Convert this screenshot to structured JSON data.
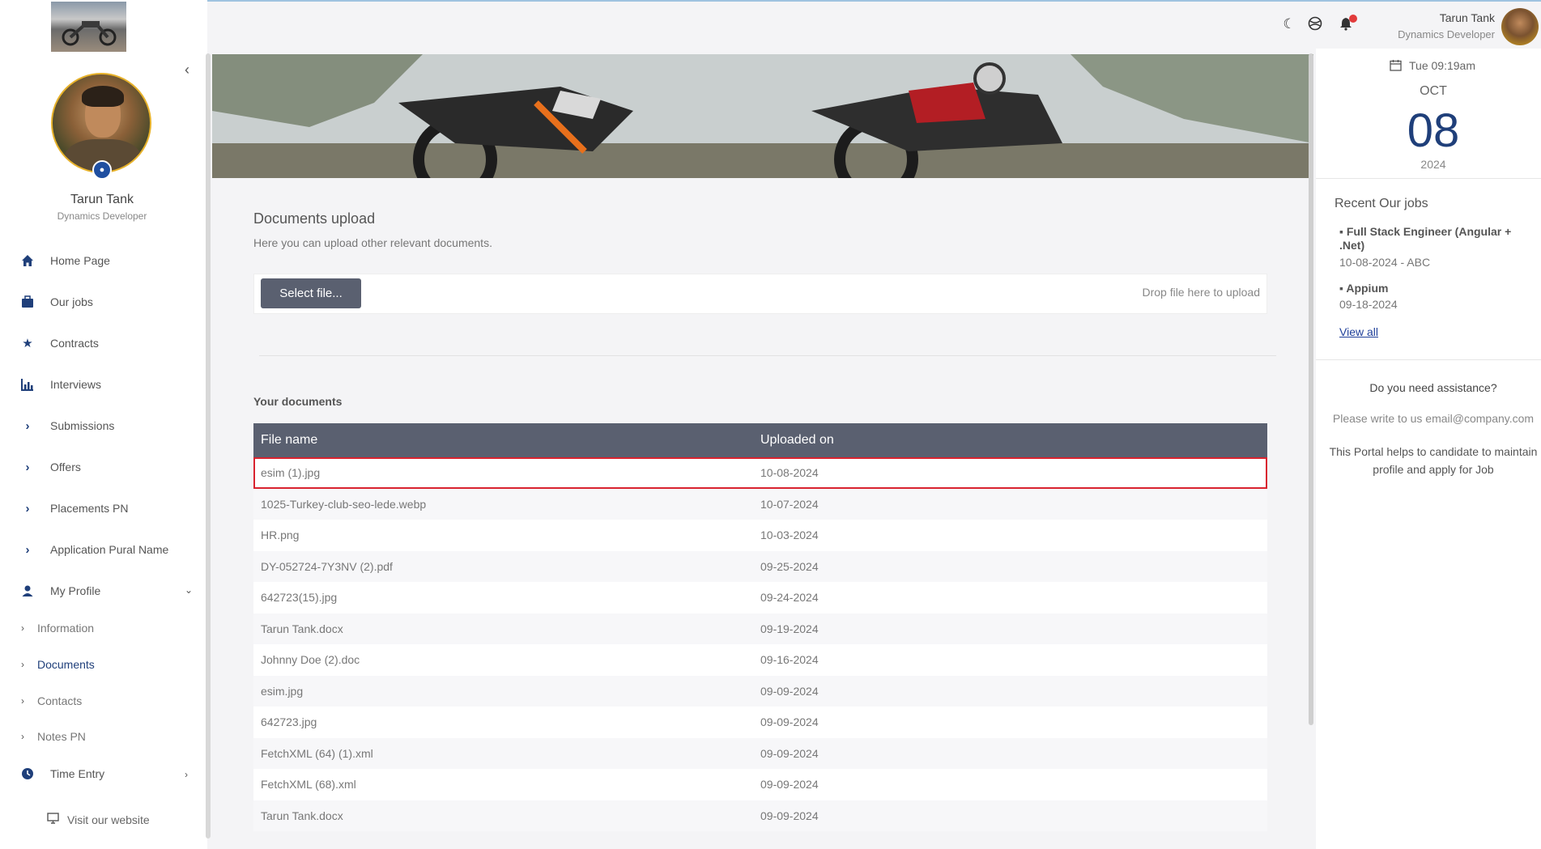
{
  "user": {
    "name": "Tarun Tank",
    "role": "Dynamics Developer"
  },
  "sidebar": {
    "items": [
      {
        "label": "Home Page",
        "icon": "home-icon"
      },
      {
        "label": "Our jobs",
        "icon": "briefcase-icon"
      },
      {
        "label": "Contracts",
        "icon": "star-icon"
      },
      {
        "label": "Interviews",
        "icon": "chart-icon"
      },
      {
        "label": "Submissions",
        "icon": "chevron-right-icon"
      },
      {
        "label": "Offers",
        "icon": "chevron-right-icon"
      },
      {
        "label": "Placements PN",
        "icon": "chevron-right-icon"
      },
      {
        "label": "Application Pural Name",
        "icon": "chevron-right-icon"
      },
      {
        "label": "My Profile",
        "icon": "user-icon"
      }
    ],
    "profile_sub": [
      {
        "label": "Information"
      },
      {
        "label": "Documents"
      },
      {
        "label": "Contacts"
      },
      {
        "label": "Notes PN"
      }
    ],
    "time_entry": {
      "label": "Time Entry"
    },
    "visit": {
      "label": "Visit our website"
    }
  },
  "header": {
    "user_name": "Tarun Tank",
    "user_role": "Dynamics Developer"
  },
  "upload": {
    "title": "Documents upload",
    "subtitle": "Here you can upload other relevant documents.",
    "select_label": "Select file...",
    "drop_hint": "Drop file here to upload"
  },
  "documents": {
    "title": "Your documents",
    "columns": [
      "File name",
      "Uploaded on"
    ],
    "rows": [
      {
        "name": "esim (1).jpg",
        "date": "10-08-2024"
      },
      {
        "name": "1025-Turkey-club-seo-lede.webp",
        "date": "10-07-2024"
      },
      {
        "name": "HR.png",
        "date": "10-03-2024"
      },
      {
        "name": "DY-052724-7Y3NV (2).pdf",
        "date": "09-25-2024"
      },
      {
        "name": "642723(15).jpg",
        "date": "09-24-2024"
      },
      {
        "name": "Tarun Tank.docx",
        "date": "09-19-2024"
      },
      {
        "name": "Johnny Doe (2).doc",
        "date": "09-16-2024"
      },
      {
        "name": "esim.jpg",
        "date": "09-09-2024"
      },
      {
        "name": "642723.jpg",
        "date": "09-09-2024"
      },
      {
        "name": "FetchXML (64) (1).xml",
        "date": "09-09-2024"
      },
      {
        "name": "FetchXML (68).xml",
        "date": "09-09-2024"
      },
      {
        "name": "Tarun Tank.docx",
        "date": "09-09-2024"
      }
    ]
  },
  "calendar": {
    "time": "Tue 09:19am",
    "month": "OCT",
    "day": "08",
    "year": "2024"
  },
  "recent_jobs": {
    "title": "Recent Our jobs",
    "items": [
      {
        "title": "Full Stack Engineer (Angular + .Net)",
        "meta": "10-08-2024 - ABC"
      },
      {
        "title": "Appium",
        "meta": "09-18-2024"
      }
    ],
    "view_all": "View all"
  },
  "assistance": {
    "question": "Do you need assistance?",
    "mail": "Please write to us email@company.com",
    "desc": "This Portal helps to candidate to maintain profile and apply for Job"
  },
  "colors": {
    "primary": "#1f3f7a",
    "table_header": "#5a6070",
    "selected_outline": "#d9232f",
    "notification": "#e23b3b"
  }
}
